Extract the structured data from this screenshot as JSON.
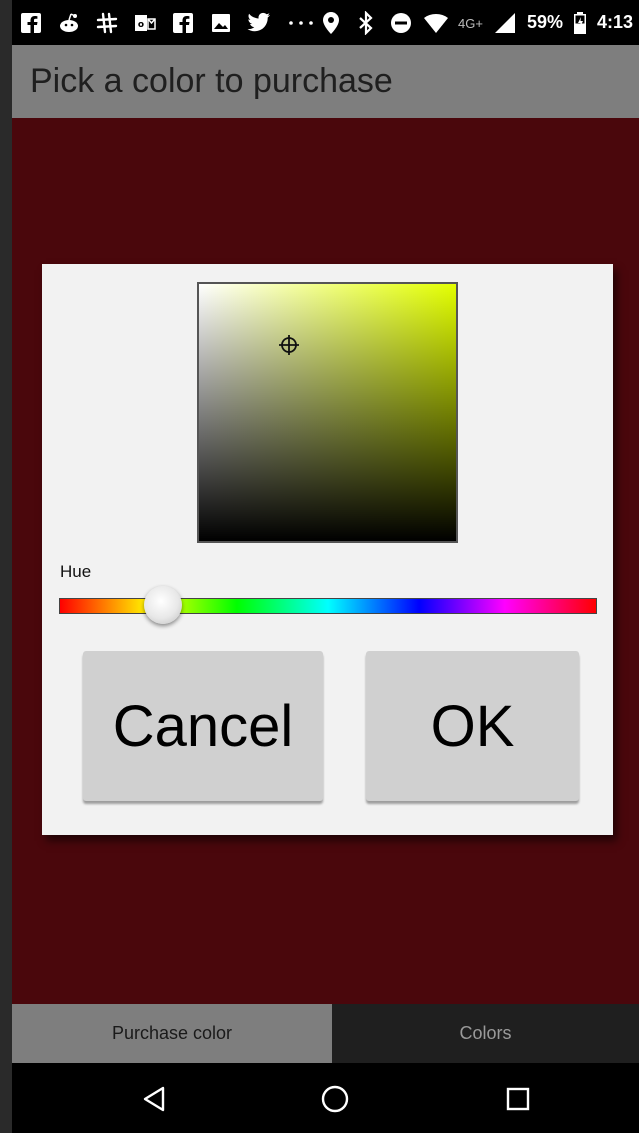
{
  "status_bar": {
    "icons_left": [
      "facebook-icon",
      "reddit-icon",
      "slack-icon",
      "outlook-icon",
      "facebook-icon",
      "image-icon",
      "twitter-icon",
      "more-icon"
    ],
    "icons_right": [
      "location-icon",
      "bluetooth-icon",
      "do-not-disturb-icon",
      "wifi-icon",
      "signal-icon",
      "battery-icon"
    ],
    "network": "4G+",
    "battery": "59%",
    "time": "4:13"
  },
  "app": {
    "title": "Pick a color to purchase"
  },
  "dialog": {
    "hue_label": "Hue",
    "hue_value_fraction": 0.19,
    "cancel_label": "Cancel",
    "ok_label": "OK"
  },
  "tabs": [
    {
      "label": "Purchase color",
      "active": true
    },
    {
      "label": "Colors",
      "active": false
    }
  ],
  "nav": [
    "back-icon",
    "home-icon",
    "recents-icon"
  ],
  "colors": {
    "background": "#4a070c",
    "title_bar": "#7e7e7e",
    "dialog": "#f2f2f2",
    "button": "#d0d0d0",
    "selected_hue": "#e3ff00"
  }
}
